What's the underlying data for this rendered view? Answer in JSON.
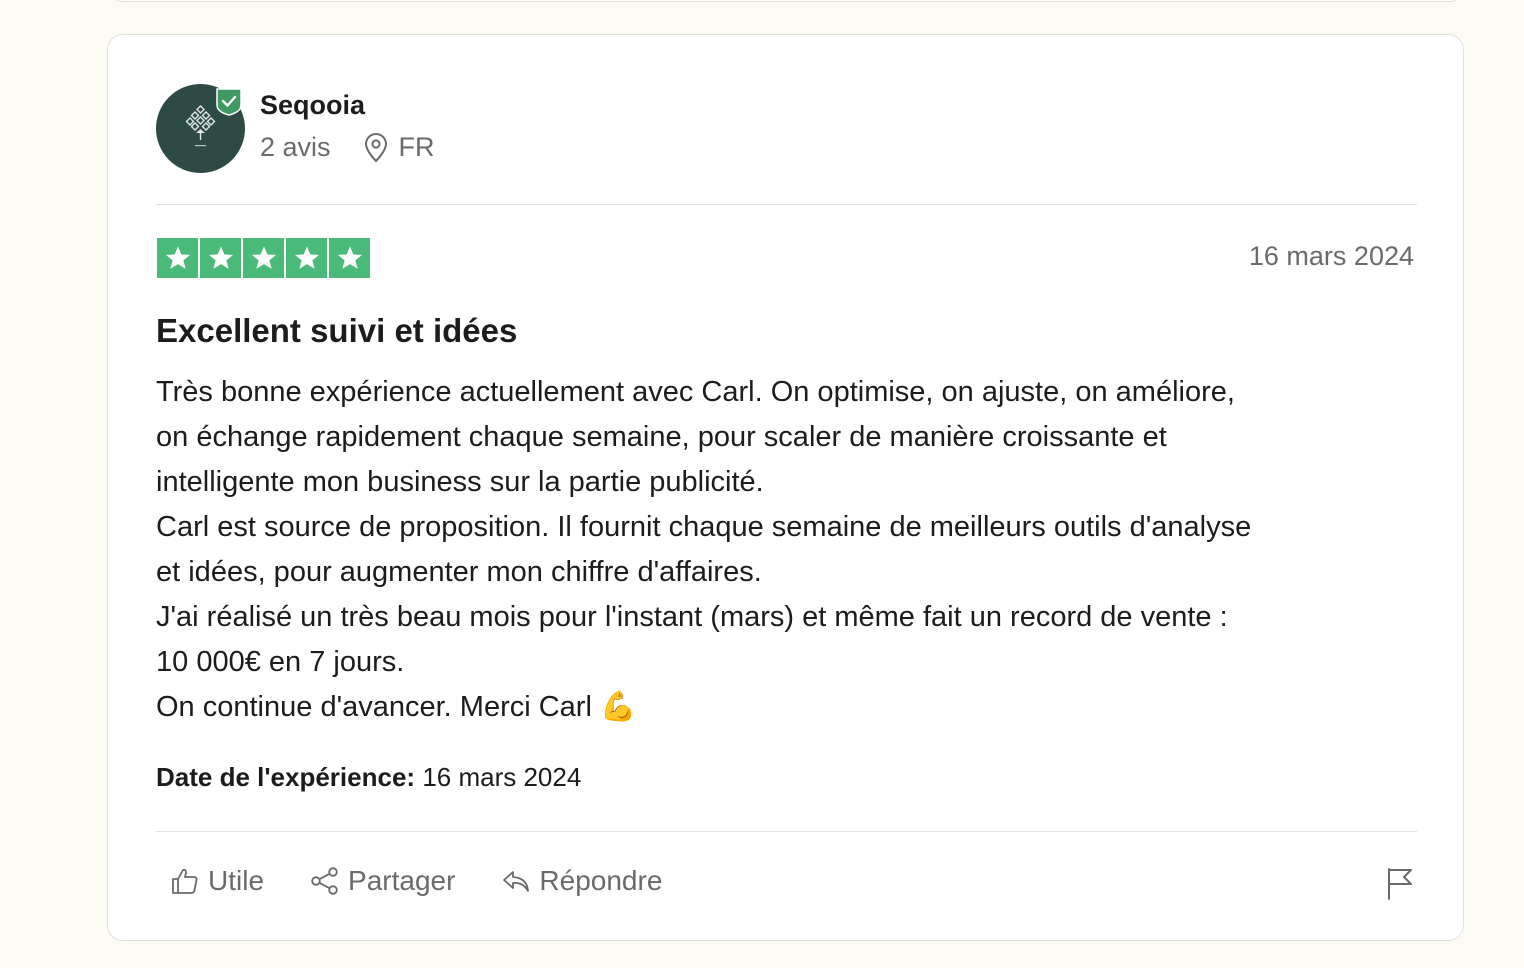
{
  "reviewer": {
    "name": "Seqooia",
    "review_count": "2 avis",
    "country": "FR",
    "avatar_icon": "tree-logo-icon",
    "verified_icon": "verified-shield-icon"
  },
  "review": {
    "rating": 5,
    "max_rating": 5,
    "date": "16 mars 2024",
    "title": "Excellent suivi et idées",
    "body_lines": [
      "Très bonne expérience actuellement avec Carl. On optimise, on ajuste, on améliore,",
      "on échange rapidement chaque semaine, pour scaler de manière croissante et",
      "intelligente mon business sur la partie publicité.",
      "Carl est source de proposition. Il fournit chaque semaine de meilleurs outils d'analyse",
      "et idées, pour augmenter mon chiffre d'affaires.",
      "J'ai réalisé un très beau mois pour l'instant (mars) et même fait un record de vente :",
      "10 000€ en 7 jours.",
      "On continue d'avancer. Merci Carl 💪"
    ],
    "experience_label": "Date de l'expérience:",
    "experience_date": "16 mars 2024"
  },
  "actions": {
    "useful_label": "Utile",
    "share_label": "Partager",
    "reply_label": "Répondre"
  },
  "colors": {
    "star_green": "#4aba79",
    "avatar_bg": "#2d4a45",
    "verified_green": "#3f9a62",
    "page_bg": "#fcfbf3"
  }
}
